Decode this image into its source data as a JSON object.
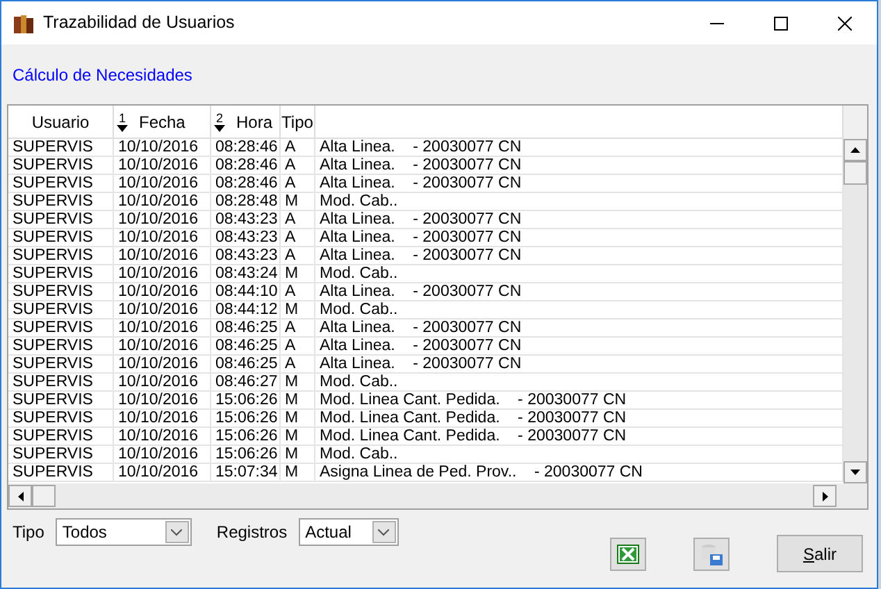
{
  "window": {
    "title": "Trazabilidad de Usuarios"
  },
  "link": "Cálculo de Necesidades",
  "table": {
    "columns": [
      {
        "label": "Usuario"
      },
      {
        "label": "Fecha",
        "sort": "1"
      },
      {
        "label": "Hora",
        "sort": "2"
      },
      {
        "label": "Tipo"
      }
    ],
    "rows": [
      [
        "SUPERVIS",
        "10/10/2016",
        "08:28:46",
        "A",
        "Alta Linea.    - 20030077 CN"
      ],
      [
        "SUPERVIS",
        "10/10/2016",
        "08:28:46",
        "A",
        "Alta Linea.    - 20030077 CN"
      ],
      [
        "SUPERVIS",
        "10/10/2016",
        "08:28:46",
        "A",
        "Alta Linea.    - 20030077 CN"
      ],
      [
        "SUPERVIS",
        "10/10/2016",
        "08:28:48",
        "M",
        "Mod. Cab.."
      ],
      [
        "SUPERVIS",
        "10/10/2016",
        "08:43:23",
        "A",
        "Alta Linea.    - 20030077 CN"
      ],
      [
        "SUPERVIS",
        "10/10/2016",
        "08:43:23",
        "A",
        "Alta Linea.    - 20030077 CN"
      ],
      [
        "SUPERVIS",
        "10/10/2016",
        "08:43:23",
        "A",
        "Alta Linea.    - 20030077 CN"
      ],
      [
        "SUPERVIS",
        "10/10/2016",
        "08:43:24",
        "M",
        "Mod. Cab.."
      ],
      [
        "SUPERVIS",
        "10/10/2016",
        "08:44:10",
        "A",
        "Alta Linea.    - 20030077 CN"
      ],
      [
        "SUPERVIS",
        "10/10/2016",
        "08:44:12",
        "M",
        "Mod. Cab.."
      ],
      [
        "SUPERVIS",
        "10/10/2016",
        "08:46:25",
        "A",
        "Alta Linea.    - 20030077 CN"
      ],
      [
        "SUPERVIS",
        "10/10/2016",
        "08:46:25",
        "A",
        "Alta Linea.    - 20030077 CN"
      ],
      [
        "SUPERVIS",
        "10/10/2016",
        "08:46:25",
        "A",
        "Alta Linea.    - 20030077 CN"
      ],
      [
        "SUPERVIS",
        "10/10/2016",
        "08:46:27",
        "M",
        "Mod. Cab.."
      ],
      [
        "SUPERVIS",
        "10/10/2016",
        "15:06:26",
        "M",
        "Mod. Linea Cant. Pedida.    - 20030077 CN"
      ],
      [
        "SUPERVIS",
        "10/10/2016",
        "15:06:26",
        "M",
        "Mod. Linea Cant. Pedida.    - 20030077 CN"
      ],
      [
        "SUPERVIS",
        "10/10/2016",
        "15:06:26",
        "M",
        "Mod. Linea Cant. Pedida.    - 20030077 CN"
      ],
      [
        "SUPERVIS",
        "10/10/2016",
        "15:06:26",
        "M",
        "Mod. Cab.."
      ],
      [
        "SUPERVIS",
        "10/10/2016",
        "15:07:34",
        "M",
        "Asigna Linea de Ped. Prov..    - 20030077 CN"
      ]
    ]
  },
  "filters": [
    {
      "label": "Tipo",
      "value": "Todos"
    },
    {
      "label": "Registros",
      "value": "Actual"
    }
  ],
  "buttons": {
    "exit": "Salir"
  }
}
